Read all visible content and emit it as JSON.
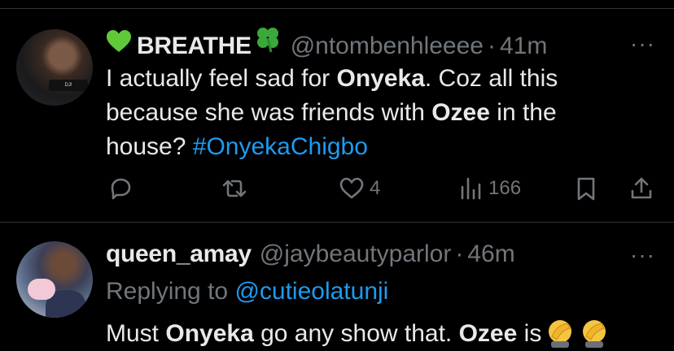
{
  "tweet1": {
    "display_name": "BREATHE",
    "handle": "@ntombenhleeee",
    "dot": "·",
    "time": "41m",
    "more": "···",
    "avatar_text": "DJ!",
    "text": {
      "l1_a": "I actually feel sad for ",
      "l1_b": "Onyeka",
      "l1_c": ". Coz all this",
      "l2_a": "because she was friends with ",
      "l2_b": "Ozee",
      "l2_c": " in the",
      "l3_a": "house? ",
      "l3_tag": "#OnyekaChigbo"
    },
    "actions": {
      "replies_icon": "comment-icon",
      "retweet_icon": "retweet-icon",
      "likes": "4",
      "views": "166",
      "bookmark_icon": "bookmark-icon",
      "share_icon": "share-icon"
    }
  },
  "tweet2": {
    "display_name": "queen_amay",
    "handle": "@jaybeautyparlor",
    "dot": "·",
    "time": "46m",
    "more": "···",
    "replying_label": "Replying to ",
    "replying_to": "@cutieolatunji",
    "text": {
      "a": "Must ",
      "b": "Onyeka",
      "c": " go any show that. ",
      "d": "Ozee",
      "e": " is"
    }
  },
  "colors": {
    "background": "#000000",
    "text": "#e7e9ea",
    "muted": "#71767b",
    "link": "#1d9bf0",
    "divider": "#2f3336"
  }
}
